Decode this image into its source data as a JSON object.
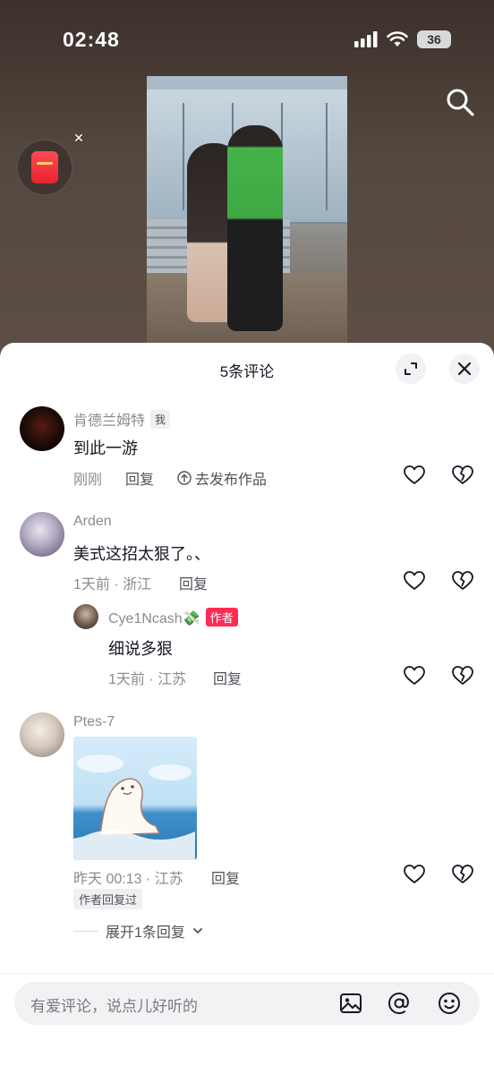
{
  "status_bar": {
    "time": "02:48",
    "battery": "36"
  },
  "comments_panel": {
    "title": "5条评论",
    "comments": [
      {
        "username": "肯德兰姆特",
        "badge": "我",
        "text": "到此一游",
        "time": "刚刚",
        "reply_label": "回复",
        "publish_label": "去发布作品"
      },
      {
        "username": "Arden",
        "text": "美式这招太狠了。、",
        "time_location": "1天前 · 浙江",
        "reply_label": "回复",
        "sub_reply": {
          "username": "Cye1Ncash💸",
          "badge": "作者",
          "text": "细说多狠",
          "time_location": "1天前 · 江苏",
          "reply_label": "回复"
        }
      },
      {
        "username": "Ptes-7",
        "time_location": "昨天 00:13 · 江苏",
        "reply_label": "回复",
        "author_tag": "作者回复过",
        "expand_label": "展开1条回复"
      }
    ]
  },
  "input": {
    "placeholder": "有爱评论，说点儿好听的"
  },
  "colors": {
    "accent": "#fe2c55",
    "text": "#161823",
    "muted": "#8a8b91"
  }
}
